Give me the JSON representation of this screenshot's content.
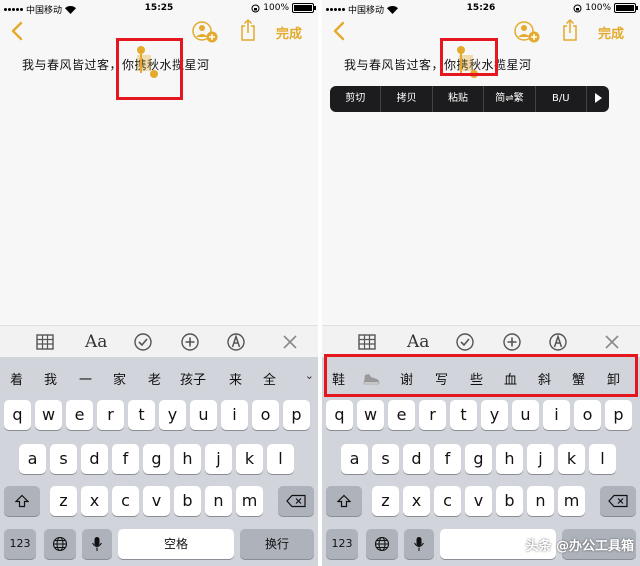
{
  "left": {
    "status": {
      "carrier": "中国移动",
      "time": "15:25",
      "battery": "100%"
    },
    "nav": {
      "done": "完成"
    },
    "note_text": "我与春风皆过客，你携秋水揽星河",
    "toolbar": {
      "aa": "Aa"
    },
    "candidates": [
      "着",
      "我",
      "一",
      "家",
      "老",
      "孩子",
      "来",
      "全"
    ],
    "keys": {
      "row1": [
        "q",
        "w",
        "e",
        "r",
        "t",
        "y",
        "u",
        "i",
        "o",
        "p"
      ],
      "row2": [
        "a",
        "s",
        "d",
        "f",
        "g",
        "h",
        "j",
        "k",
        "l"
      ],
      "row3": [
        "z",
        "x",
        "c",
        "v",
        "b",
        "n",
        "m"
      ],
      "numbers": "123",
      "space": "空格",
      "return": "换行"
    }
  },
  "right": {
    "status": {
      "carrier": "中国移动",
      "time": "15:26",
      "battery": "100%"
    },
    "nav": {
      "done": "完成"
    },
    "note_text": "我与春风皆过客，你携秋水揽星河",
    "menu": [
      "剪切",
      "拷贝",
      "粘贴",
      "简⇌繁",
      "B/U"
    ],
    "toolbar": {
      "aa": "Aa"
    },
    "candidates": [
      "鞋",
      "谢",
      "写",
      "些",
      "血",
      "斜",
      "蟹",
      "卸"
    ],
    "keys": {
      "row1": [
        "q",
        "w",
        "e",
        "r",
        "t",
        "y",
        "u",
        "i",
        "o",
        "p"
      ],
      "row2": [
        "a",
        "s",
        "d",
        "f",
        "g",
        "h",
        "j",
        "k",
        "l"
      ],
      "row3": [
        "z",
        "x",
        "c",
        "v",
        "b",
        "n",
        "m"
      ],
      "numbers": "123"
    }
  },
  "watermark": "头条 @办公工具箱",
  "colors": {
    "accent": "#e3aa2c",
    "highlight": "#e3171d",
    "keyboard_bg": "#d1d4da"
  }
}
